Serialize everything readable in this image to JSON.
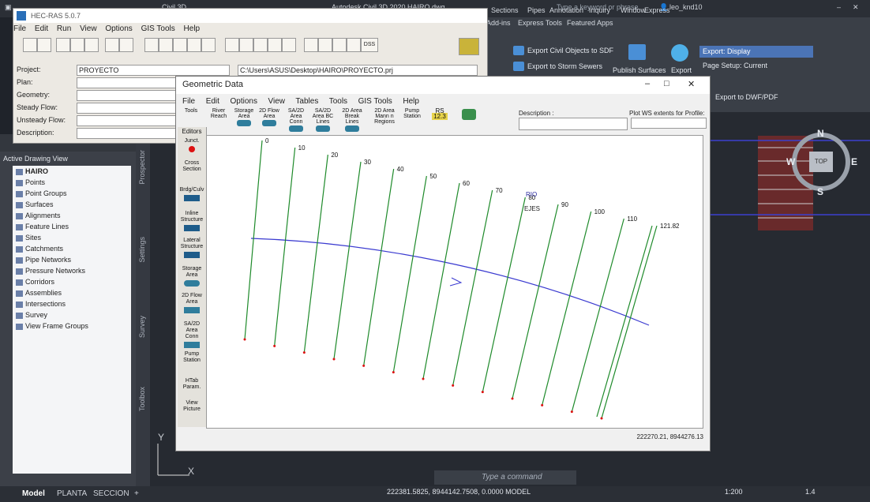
{
  "civil3d": {
    "title_left": "Civil 3D",
    "title_center": "Autodesk Civil 3D 2020   HAIRO.dwg",
    "search_placeholder": "Type a keyword or phrase",
    "user": "leo_knd10",
    "ribbon_tabs": [
      "Add-ins",
      "Sections",
      "Pipes",
      "Annotation",
      "Inquiry",
      "Window",
      "Express Tools",
      "Featured Apps",
      "Express"
    ],
    "export_civil": "Export Civil Objects to SDF",
    "export_storm": "Export to Storm Sewers",
    "publish_surfaces": "Publish Surfaces",
    "export_label": "Export",
    "export_display": "Export: Display",
    "page_setup": "Page Setup: Current",
    "export_dwf": "Export to DWF/PDF",
    "command_placeholder": "Type a command",
    "model_tabs": [
      "Model",
      "PLANTA",
      "SECCION"
    ],
    "coords": "222381.5825, 8944142.7508, 0.0000  MODEL",
    "scale": "1:200",
    "lineweight": "1.4",
    "compass": {
      "n": "N",
      "s": "S",
      "w": "W",
      "e": "E",
      "top": "TOP"
    },
    "ucs": {
      "y": "Y",
      "x": "X"
    }
  },
  "prospector": {
    "header": "Active Drawing View",
    "root": "HAIRO",
    "items": [
      "Points",
      "Point Groups",
      "Surfaces",
      "Alignments",
      "Feature Lines",
      "Sites",
      "Catchments",
      "Pipe Networks",
      "Pressure Networks",
      "Corridors",
      "Assemblies",
      "Intersections",
      "Survey",
      "View Frame Groups"
    ],
    "side_tabs": [
      "Prospector",
      "Settings",
      "Survey",
      "Toolbox"
    ]
  },
  "hecras": {
    "title": "HEC-RAS 5.0.7",
    "menu": [
      "File",
      "Edit",
      "Run",
      "View",
      "Options",
      "GIS Tools",
      "Help"
    ],
    "labels": {
      "project": "Project:",
      "plan": "Plan:",
      "geometry": "Geometry:",
      "steady": "Steady Flow:",
      "unsteady": "Unsteady Flow:",
      "description": "Description:"
    },
    "project_value": "PROYECTO",
    "project_path": "C:\\Users\\ASUS\\Desktop\\HAIRO\\PROYECTO.prj",
    "dss": "DSS"
  },
  "geometric": {
    "title": "Geometric Data",
    "menu": [
      "File",
      "Edit",
      "Options",
      "View",
      "Tables",
      "Tools",
      "GIS Tools",
      "Help"
    ],
    "toolbar": [
      "Tools",
      "River Reach",
      "Storage Area",
      "2D Flow Area",
      "SA/2D Area Conn",
      "SA/2D Area BC Lines",
      "2D Area Break Lines",
      "2D Area Mann n Regions",
      "Pump Station",
      "RS"
    ],
    "rs_value": "12.3",
    "description_label": "Description :",
    "plot_ws": "Plot WS extents for Profile:",
    "editors_label": "Editors",
    "editors": [
      "Junct.",
      "Cross Section",
      "Brdg/Culv",
      "Inline Structure",
      "Lateral Structure",
      "Storage Area",
      "2D Flow Area",
      "SA/2D Area Conn",
      "Pump Station",
      "HTab Param.",
      "View Picture"
    ],
    "river_label": "RIO",
    "reach_label": "EJES",
    "stations": [
      "0",
      "10",
      "20",
      "30",
      "40",
      "50",
      "60",
      "70",
      "80",
      "90",
      "100",
      "110",
      "121.82"
    ],
    "status_coords": "222270.21, 8944276.13"
  }
}
